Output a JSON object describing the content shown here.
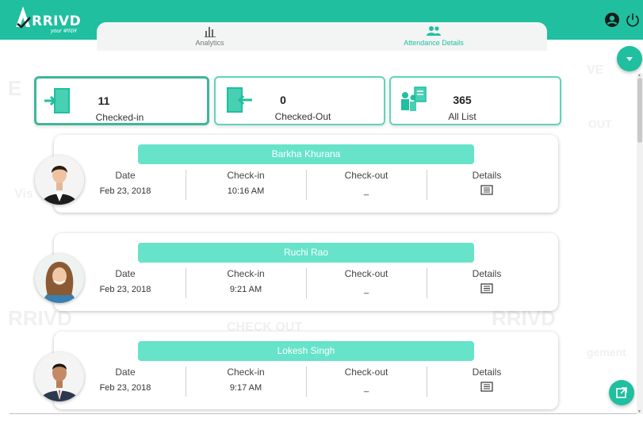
{
  "header": {
    "logo_text": "RRIVD",
    "logo_sub": "your बगदल",
    "bg_color": "#1fbf9f"
  },
  "tabs": [
    {
      "label": "Analytics",
      "icon": "bar-chart-icon",
      "active": false
    },
    {
      "label": "Attendance Details",
      "icon": "people-icon",
      "active": true
    }
  ],
  "stats": [
    {
      "value": "11",
      "label": "Checked-in",
      "icon": "door-enter-icon",
      "active": true
    },
    {
      "value": "0",
      "label": "Checked-Out",
      "icon": "door-exit-icon",
      "active": false
    },
    {
      "value": "365",
      "label": "All List",
      "icon": "people-list-icon",
      "active": false
    }
  ],
  "columns": {
    "date": "Date",
    "check_in": "Check-in",
    "check_out": "Check-out",
    "details": "Details"
  },
  "people": [
    {
      "name": "Barkha Khurana",
      "date": "Feb 23, 2018",
      "check_in": "10:16 AM",
      "check_out": "_"
    },
    {
      "name": "Ruchi Rao",
      "date": "Feb 23, 2018",
      "check_in": "9:21 AM",
      "check_out": "_"
    },
    {
      "name": "Lokesh Singh",
      "date": "Feb 23, 2018",
      "check_in": "9:17 AM",
      "check_out": "_"
    }
  ],
  "colors": {
    "accent": "#1fbf9f",
    "pill": "#66e3c9",
    "card_border": "#5fd4b8"
  }
}
